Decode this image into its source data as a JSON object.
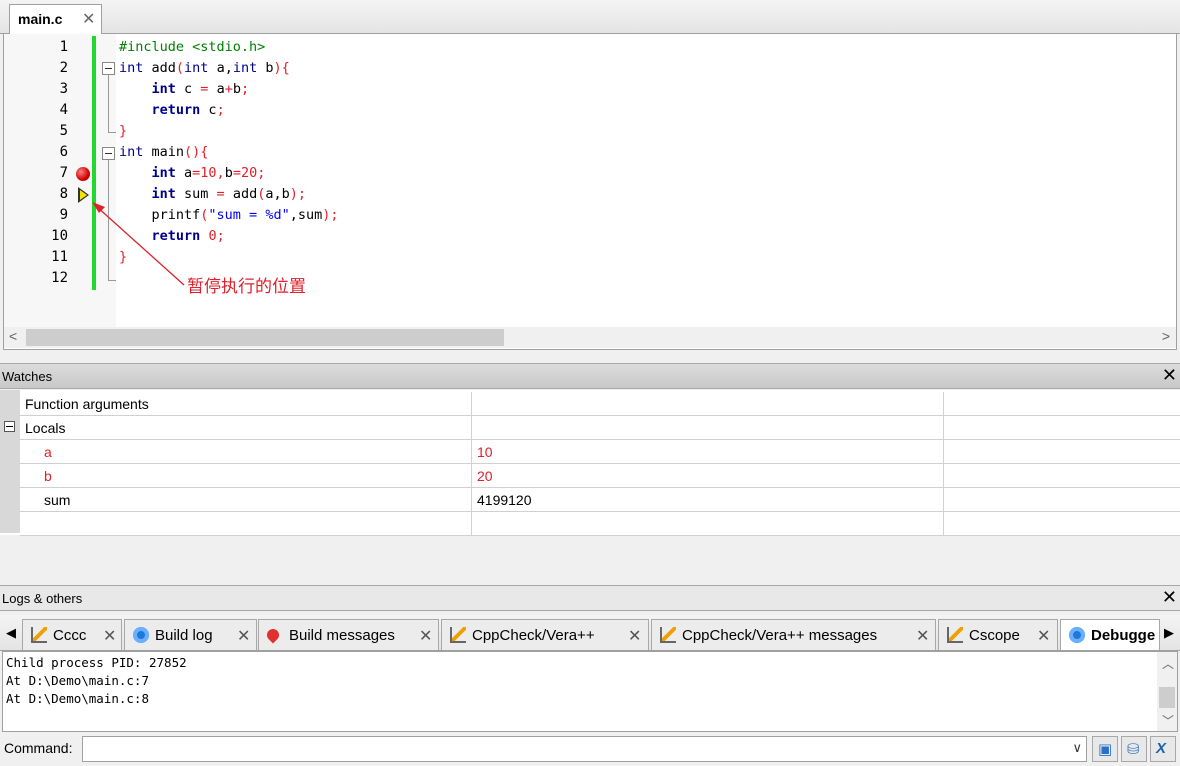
{
  "editor": {
    "tab_label": "main.c",
    "line_numbers": [
      "1",
      "2",
      "3",
      "4",
      "5",
      "6",
      "7",
      "8",
      "9",
      "10",
      "11",
      "12"
    ],
    "annotation": "暂停执行的位置"
  },
  "watches": {
    "title": "Watches",
    "rows": [
      {
        "name": "Function arguments",
        "value": "",
        "indent": 0
      },
      {
        "name": "Locals",
        "value": "",
        "indent": 0,
        "expanded": true
      },
      {
        "name": "a",
        "value": "10",
        "changed": true
      },
      {
        "name": "b",
        "value": "20",
        "changed": true
      },
      {
        "name": "sum",
        "value": "4199120",
        "changed": false
      }
    ]
  },
  "logs": {
    "title": "Logs & others",
    "tabs": [
      {
        "label": "Cccc",
        "icon": "pencil-icon"
      },
      {
        "label": "Build log",
        "icon": "gear-icon"
      },
      {
        "label": "Build messages",
        "icon": "pin-icon"
      },
      {
        "label": "CppCheck/Vera++",
        "icon": "pencil-icon"
      },
      {
        "label": "CppCheck/Vera++ messages",
        "icon": "pencil-icon"
      },
      {
        "label": "Cscope",
        "icon": "pencil-icon"
      },
      {
        "label": "Debugge",
        "icon": "gear-icon",
        "active": true
      }
    ],
    "lines": [
      "Child process PID: 27852",
      "At D:\\Demo\\main.c:7",
      "At D:\\Demo\\main.c:8"
    ],
    "command_label": "Command:",
    "command_value": ""
  },
  "colors": {
    "changebar": "#21d92e",
    "keyword": "#00008b",
    "literal": "#e0202a",
    "preprocessor": "#008000",
    "string": "#0000ff"
  }
}
